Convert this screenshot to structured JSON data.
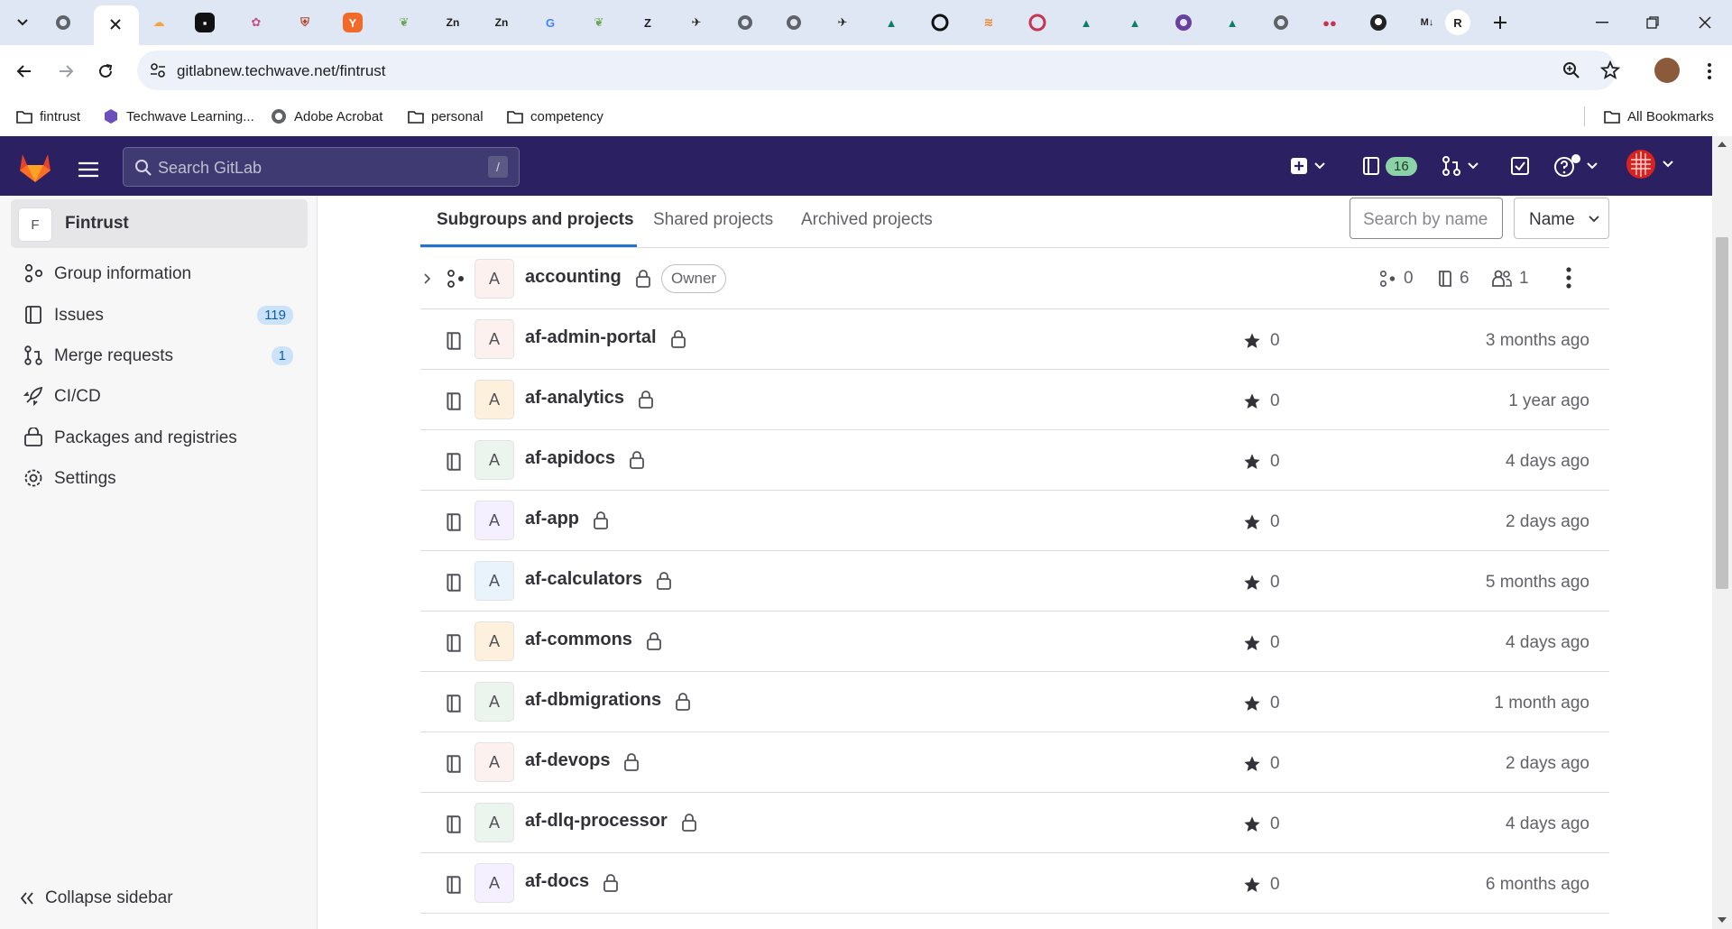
{
  "browser": {
    "url": "gitlabnew.techwave.net/fintrust",
    "bookmarks": [
      "fintrust",
      "Techwave Learning...",
      "Adobe Acrobat",
      "personal",
      "competency"
    ],
    "all_bookmarks": "All Bookmarks"
  },
  "header": {
    "search_placeholder": "Search GitLab",
    "search_shortcut": "/",
    "issues_count": "16"
  },
  "sidebar": {
    "group_avatar": "F",
    "group_name": "Fintrust",
    "items": [
      {
        "label": "Group information",
        "icon": "group-icon"
      },
      {
        "label": "Issues",
        "icon": "issues-icon",
        "badge": "119"
      },
      {
        "label": "Merge requests",
        "icon": "merge-request-icon",
        "badge": "1"
      },
      {
        "label": "CI/CD",
        "icon": "rocket-icon"
      },
      {
        "label": "Packages and registries",
        "icon": "package-icon"
      },
      {
        "label": "Settings",
        "icon": "settings-icon"
      }
    ],
    "collapse_label": "Collapse sidebar"
  },
  "main": {
    "tabs": [
      "Subgroups and projects",
      "Shared projects",
      "Archived projects"
    ],
    "filter_placeholder": "Search by name",
    "sort_label": "Name",
    "subgroup": {
      "avatar": "A",
      "name": "accounting",
      "role": "Owner",
      "subgroups": "0",
      "projects": "6",
      "members": "1"
    },
    "projects": [
      {
        "avatar": "A",
        "name": "af-admin-portal",
        "stars": "0",
        "updated": "3 months ago",
        "color": "#fcf1ef"
      },
      {
        "avatar": "A",
        "name": "af-analytics",
        "stars": "0",
        "updated": "1 year ago",
        "color": "#fdf1dd"
      },
      {
        "avatar": "A",
        "name": "af-apidocs",
        "stars": "0",
        "updated": "4 days ago",
        "color": "#ecf4ee"
      },
      {
        "avatar": "A",
        "name": "af-app",
        "stars": "0",
        "updated": "2 days ago",
        "color": "#f4f0ff"
      },
      {
        "avatar": "A",
        "name": "af-calculators",
        "stars": "0",
        "updated": "5 months ago",
        "color": "#e9f3fc"
      },
      {
        "avatar": "A",
        "name": "af-commons",
        "stars": "0",
        "updated": "4 days ago",
        "color": "#fdf1dd"
      },
      {
        "avatar": "A",
        "name": "af-dbmigrations",
        "stars": "0",
        "updated": "1 month ago",
        "color": "#ecf4ee"
      },
      {
        "avatar": "A",
        "name": "af-devops",
        "stars": "0",
        "updated": "2 days ago",
        "color": "#fcf1ef"
      },
      {
        "avatar": "A",
        "name": "af-dlq-processor",
        "stars": "0",
        "updated": "4 days ago",
        "color": "#ecf4ee"
      },
      {
        "avatar": "A",
        "name": "af-docs",
        "stars": "0",
        "updated": "6 months ago",
        "color": "#f4f0ff"
      }
    ]
  }
}
